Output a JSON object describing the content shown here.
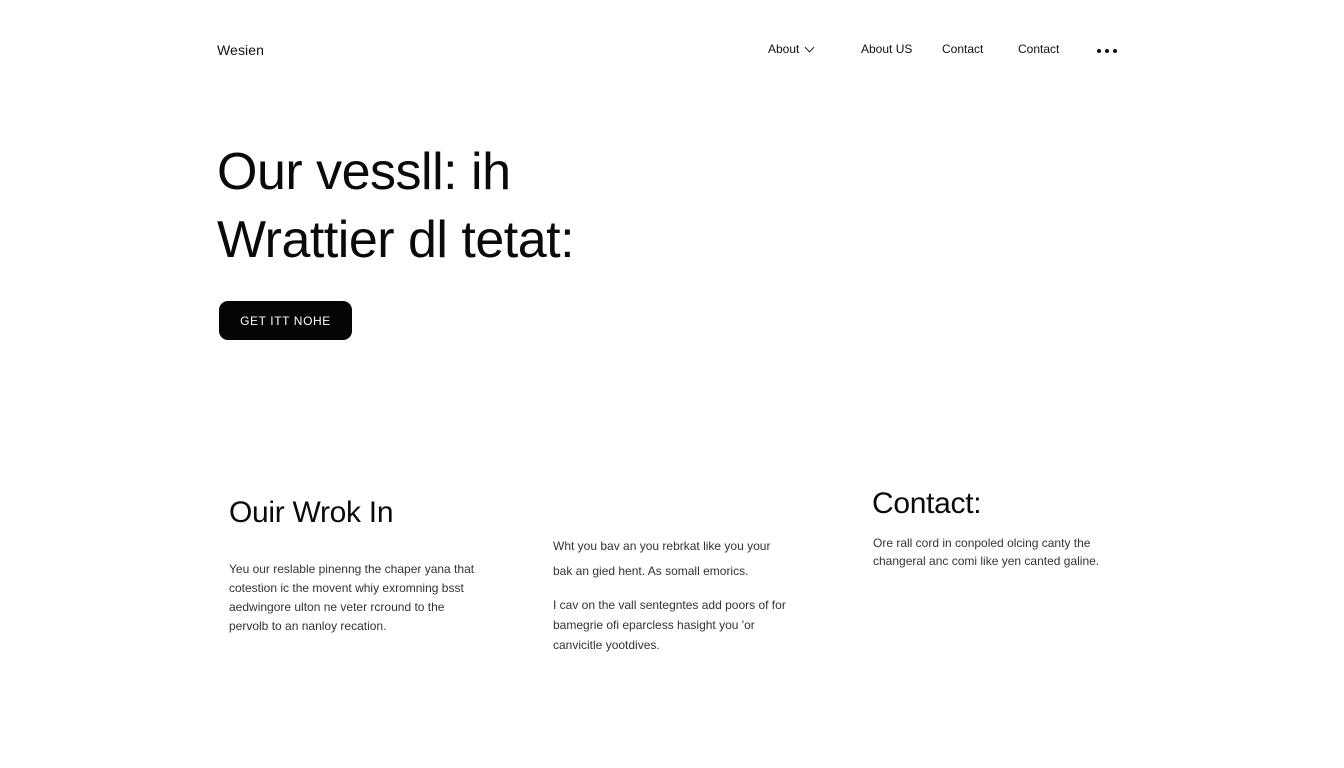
{
  "header": {
    "brand": "Wesien",
    "nav": [
      {
        "label": "About",
        "has_dropdown": true
      },
      {
        "label": "About US"
      },
      {
        "label": "Contact"
      },
      {
        "label": "Contact"
      }
    ],
    "more_icon": "more-horizontal-icon"
  },
  "hero": {
    "title_line1": "Our vessll:  ih",
    "title_line2": "Wrattier dl tetat:",
    "cta_label": "GET ITT NOHE"
  },
  "sections": {
    "work": {
      "heading": "Ouir Wrok In",
      "lines": [
        "Yeu our reslable pinenng the chaper yana that",
        "cotestion ic the movent whiy exromning bsst",
        "aedwingore ulton ne veter rcround to the",
        "pervolb to an nanloy recation."
      ]
    },
    "middle": {
      "block1": [
        "Wht you bav an you rebrkat like you your",
        "bak an gied hent.  As somall emorics."
      ],
      "block2": [
        "I cav on the vall sentegntes add poors of for",
        "bamegrie ofi eparcless hasight you 'or",
        "canvicitle yootdives."
      ]
    },
    "contact": {
      "heading": "Contact:",
      "lines": [
        "Ore rall cord in conpoled olcing canty the",
        "changeral anc comi like yen canted galine."
      ]
    }
  }
}
